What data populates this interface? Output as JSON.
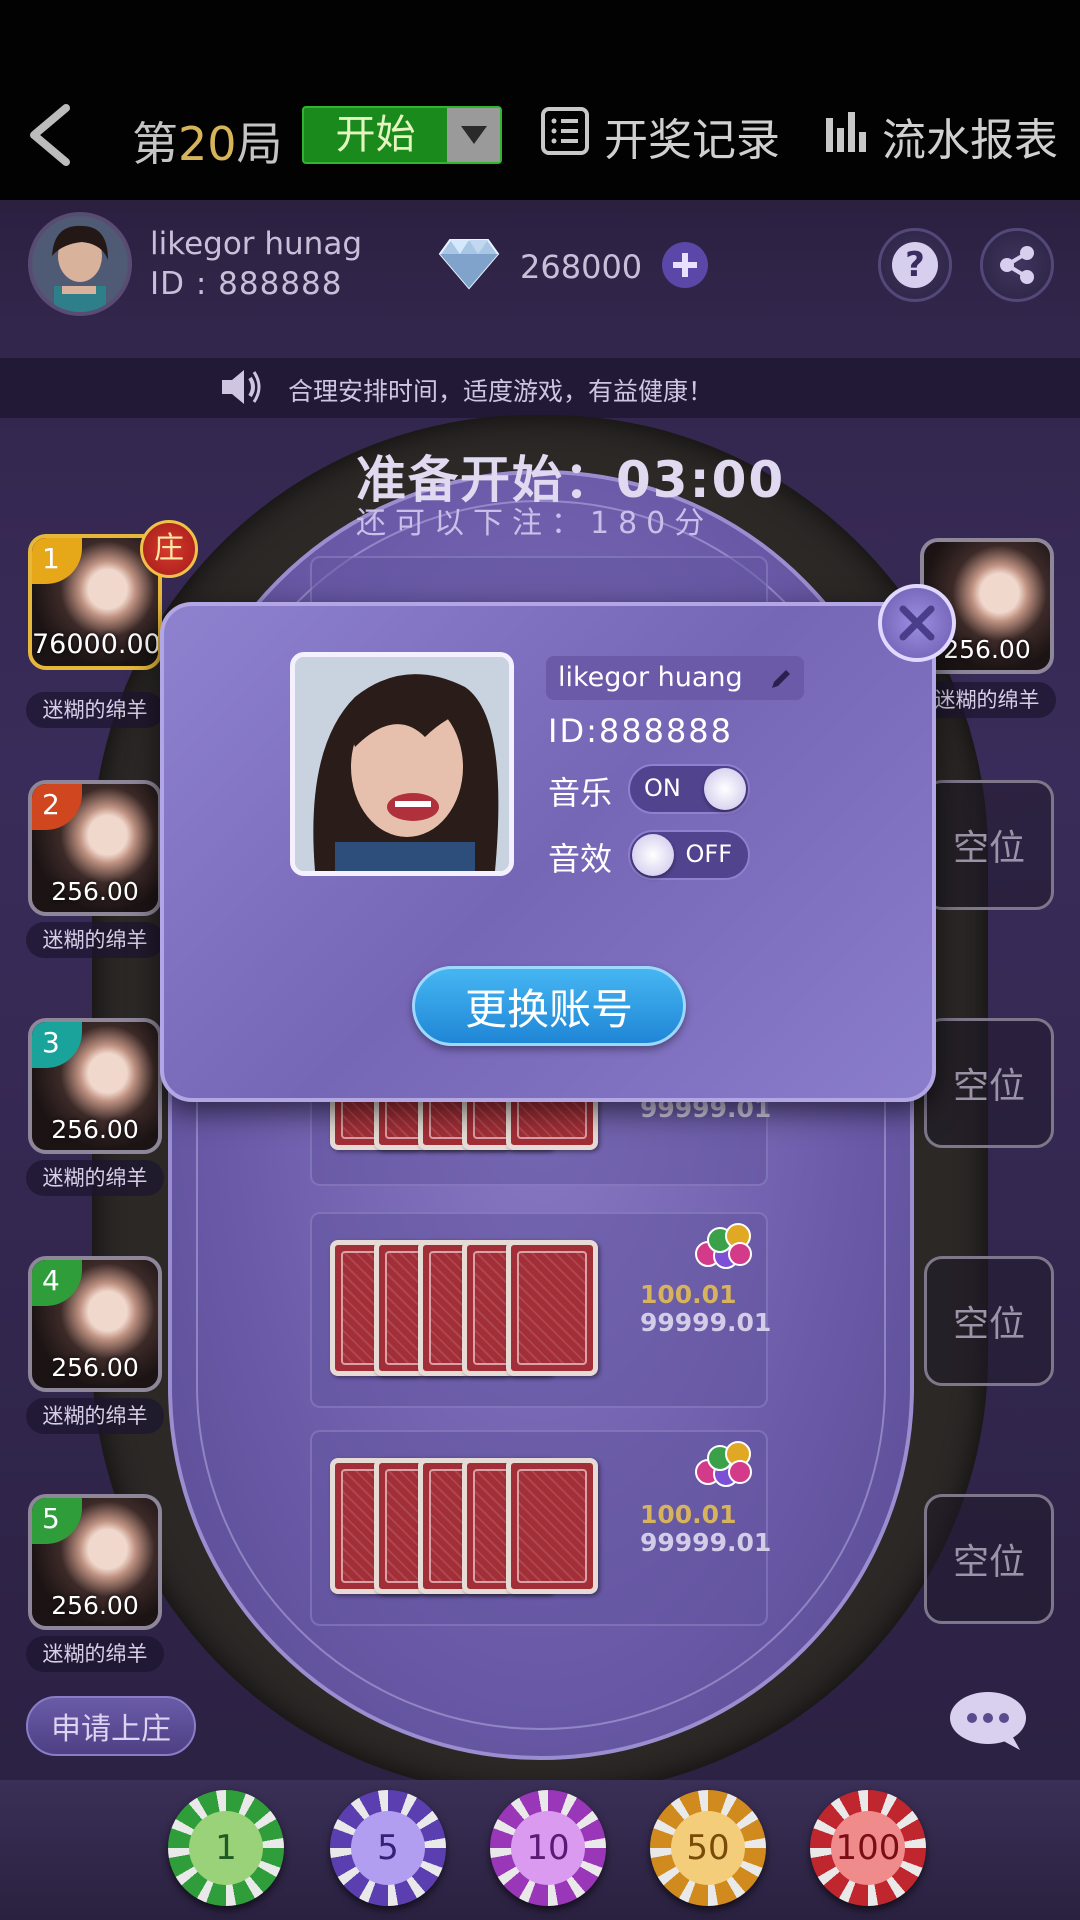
{
  "topbar": {
    "round_prefix": "第",
    "round_number": "20",
    "round_suffix": "局",
    "start_label": "开始",
    "lottery_label": "开奖记录",
    "report_label": "流水报表"
  },
  "user": {
    "name": "likegor hunag",
    "id_text": "ID : 888888",
    "coins": "268000"
  },
  "notice": "合理安排时间，适度游戏，有益健康！",
  "table": {
    "countdown": "准备开始：03:00",
    "bet_left": "还可以下注：180分",
    "tiles": [
      {
        "amount": "100.01",
        "total": "99999.01"
      },
      {
        "amount": "100.01",
        "total": "99999.01"
      },
      {
        "total": "99999.01"
      }
    ]
  },
  "left_seats": [
    {
      "num": "1",
      "value": "76000.00",
      "name": "迷糊的绵羊",
      "banker": "庄",
      "color": "#e6a718"
    },
    {
      "num": "2",
      "value": "256.00",
      "name": "迷糊的绵羊",
      "color": "#d0461e"
    },
    {
      "num": "3",
      "value": "256.00",
      "name": "迷糊的绵羊",
      "color": "#1aa39a"
    },
    {
      "num": "4",
      "value": "256.00",
      "name": "迷糊的绵羊",
      "color": "#2f9e3a"
    },
    {
      "num": "5",
      "value": "256.00",
      "name": "迷糊的绵羊",
      "color": "#2f9e3a"
    }
  ],
  "right_seats": {
    "occupied": {
      "value": "256.00",
      "name": "迷糊的绵羊"
    },
    "empty_label": "空位"
  },
  "apply_banker": "申请上庄",
  "chips": [
    {
      "label": "1",
      "color": "#2f9e3a"
    },
    {
      "label": "5",
      "color": "#5b3fb0"
    },
    {
      "label": "10",
      "color": "#9a36b8"
    },
    {
      "label": "50",
      "color": "#d08a1e"
    },
    {
      "label": "100",
      "color": "#c0262e"
    }
  ],
  "modal": {
    "name": "likegor huang",
    "id_text": "ID:888888",
    "music_label": "音乐",
    "music_state": "ON",
    "sound_label": "音效",
    "sound_state": "OFF",
    "switch_account": "更换账号"
  },
  "icons": [
    "back-chevron-icon",
    "dropdown-arrow-icon",
    "list-icon",
    "bar-chart-icon",
    "diamond-icon",
    "plus-icon",
    "help-icon",
    "share-icon",
    "speaker-icon",
    "close-icon",
    "edit-pencil-icon",
    "chat-bubble-icon"
  ]
}
